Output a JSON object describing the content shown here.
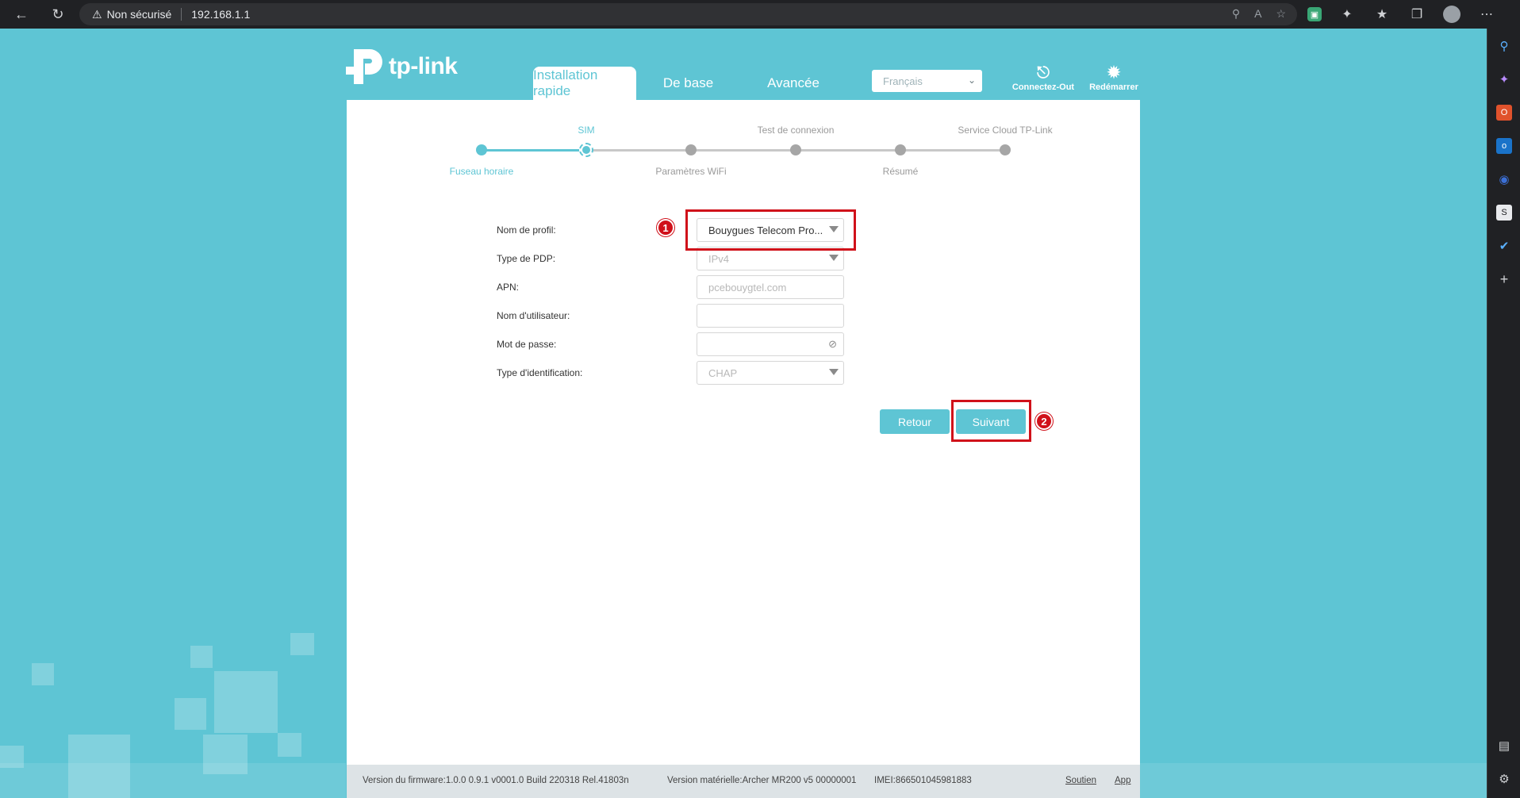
{
  "browser": {
    "security_warning": "Non sécurisé",
    "url": "192.168.1.1"
  },
  "header": {
    "logo_text": "tp-link",
    "tabs": [
      "Installation rapide",
      "De base",
      "Avancée"
    ],
    "language": "Français",
    "logout_label": "Connectez-Out",
    "reboot_label": "Redémarrer"
  },
  "progress": {
    "steps_top": [
      "SIM",
      "Test de connexion",
      "Service Cloud TP-Link"
    ],
    "steps_bottom": [
      "Fuseau horaire",
      "Paramètres WiFi",
      "Résumé"
    ],
    "current_step": 2,
    "total_steps": 6
  },
  "form": {
    "profile_label": "Nom de profil:",
    "profile_value": "Bouygues Telecom Pro...",
    "pdp_label": "Type de PDP:",
    "pdp_value": "IPv4",
    "apn_label": "APN:",
    "apn_value": "pcebouygtel.com",
    "username_label": "Nom d'utilisateur:",
    "username_value": "",
    "password_label": "Mot de passe:",
    "password_value": "",
    "auth_label": "Type d'identification:",
    "auth_value": "CHAP"
  },
  "buttons": {
    "back": "Retour",
    "next": "Suivant"
  },
  "annotations": {
    "badge_1": "1",
    "badge_2": "2",
    "color": "#d0111a"
  },
  "footer": {
    "firmware": "Version du firmware:1.0.0 0.9.1 v0001.0 Build 220318 Rel.41803n",
    "hardware": "Version matérielle:Archer MR200 v5 00000001",
    "imei": "IMEI:866501045981883",
    "support": "Soutien",
    "app": "App"
  },
  "colors": {
    "accent": "#5ec5d4",
    "browser_dark": "#202124"
  }
}
